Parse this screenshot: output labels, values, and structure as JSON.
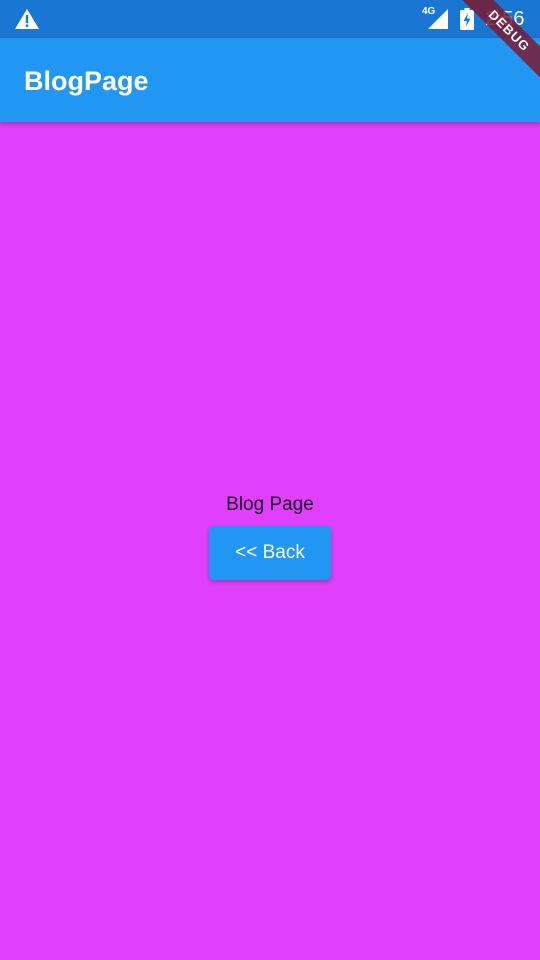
{
  "status_bar": {
    "network_label": "4G",
    "time": "2:56",
    "icons": [
      "warning-icon",
      "signal-icon",
      "battery-charging-icon"
    ]
  },
  "app_bar": {
    "title": "BlogPage"
  },
  "debug_banner": {
    "label": "DEBUG"
  },
  "body": {
    "text": "Blog Page",
    "back_button_label": "<< Back"
  },
  "colors": {
    "status_bar": "#1976D2",
    "app_bar": "#2196F3",
    "background": "#E040FB",
    "button": "#2196F3"
  }
}
